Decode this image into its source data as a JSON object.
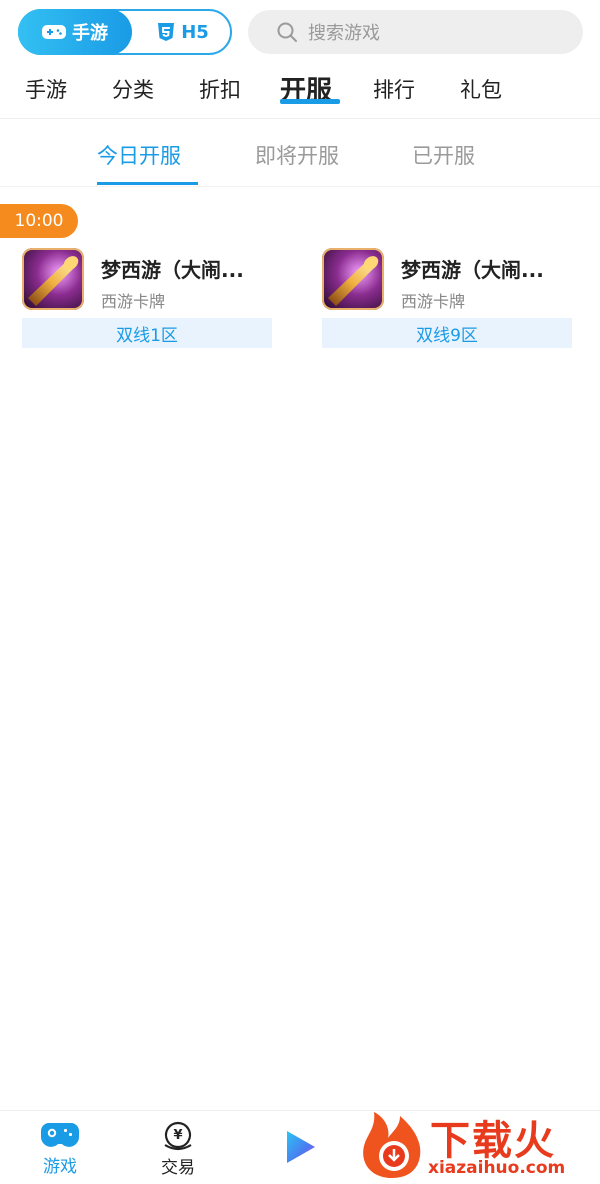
{
  "top": {
    "segment": {
      "active_label": "手游",
      "h5_label": "H5"
    },
    "search": {
      "placeholder": "搜索游戏"
    }
  },
  "nav": {
    "items": [
      {
        "label": "手游"
      },
      {
        "label": "分类"
      },
      {
        "label": "折扣"
      },
      {
        "label": "开服",
        "active": true
      },
      {
        "label": "排行"
      },
      {
        "label": "礼包"
      }
    ]
  },
  "subtabs": [
    {
      "label": "今日开服",
      "active": true
    },
    {
      "label": "即将开服"
    },
    {
      "label": "已开服"
    }
  ],
  "time_badge": "10:00",
  "games": [
    {
      "name": "梦西游（大闹...",
      "genre": "西游卡牌",
      "server": "双线1区"
    },
    {
      "name": "梦西游（大闹...",
      "genre": "西游卡牌",
      "server": "双线9区"
    }
  ],
  "bottom_tabs": [
    {
      "label": "游戏",
      "icon": "gamepad-icon",
      "active": true
    },
    {
      "label": "交易",
      "icon": "yen-bag-icon"
    },
    {
      "label": "",
      "icon": "play-icon"
    }
  ],
  "watermark": {
    "text": "下载火",
    "url": "xiazaihuo.com"
  },
  "colors": {
    "accent": "#1a9be6",
    "orange": "#f58a1f",
    "server_bg": "#e9f3fd",
    "watermark": "#e83a1c"
  }
}
